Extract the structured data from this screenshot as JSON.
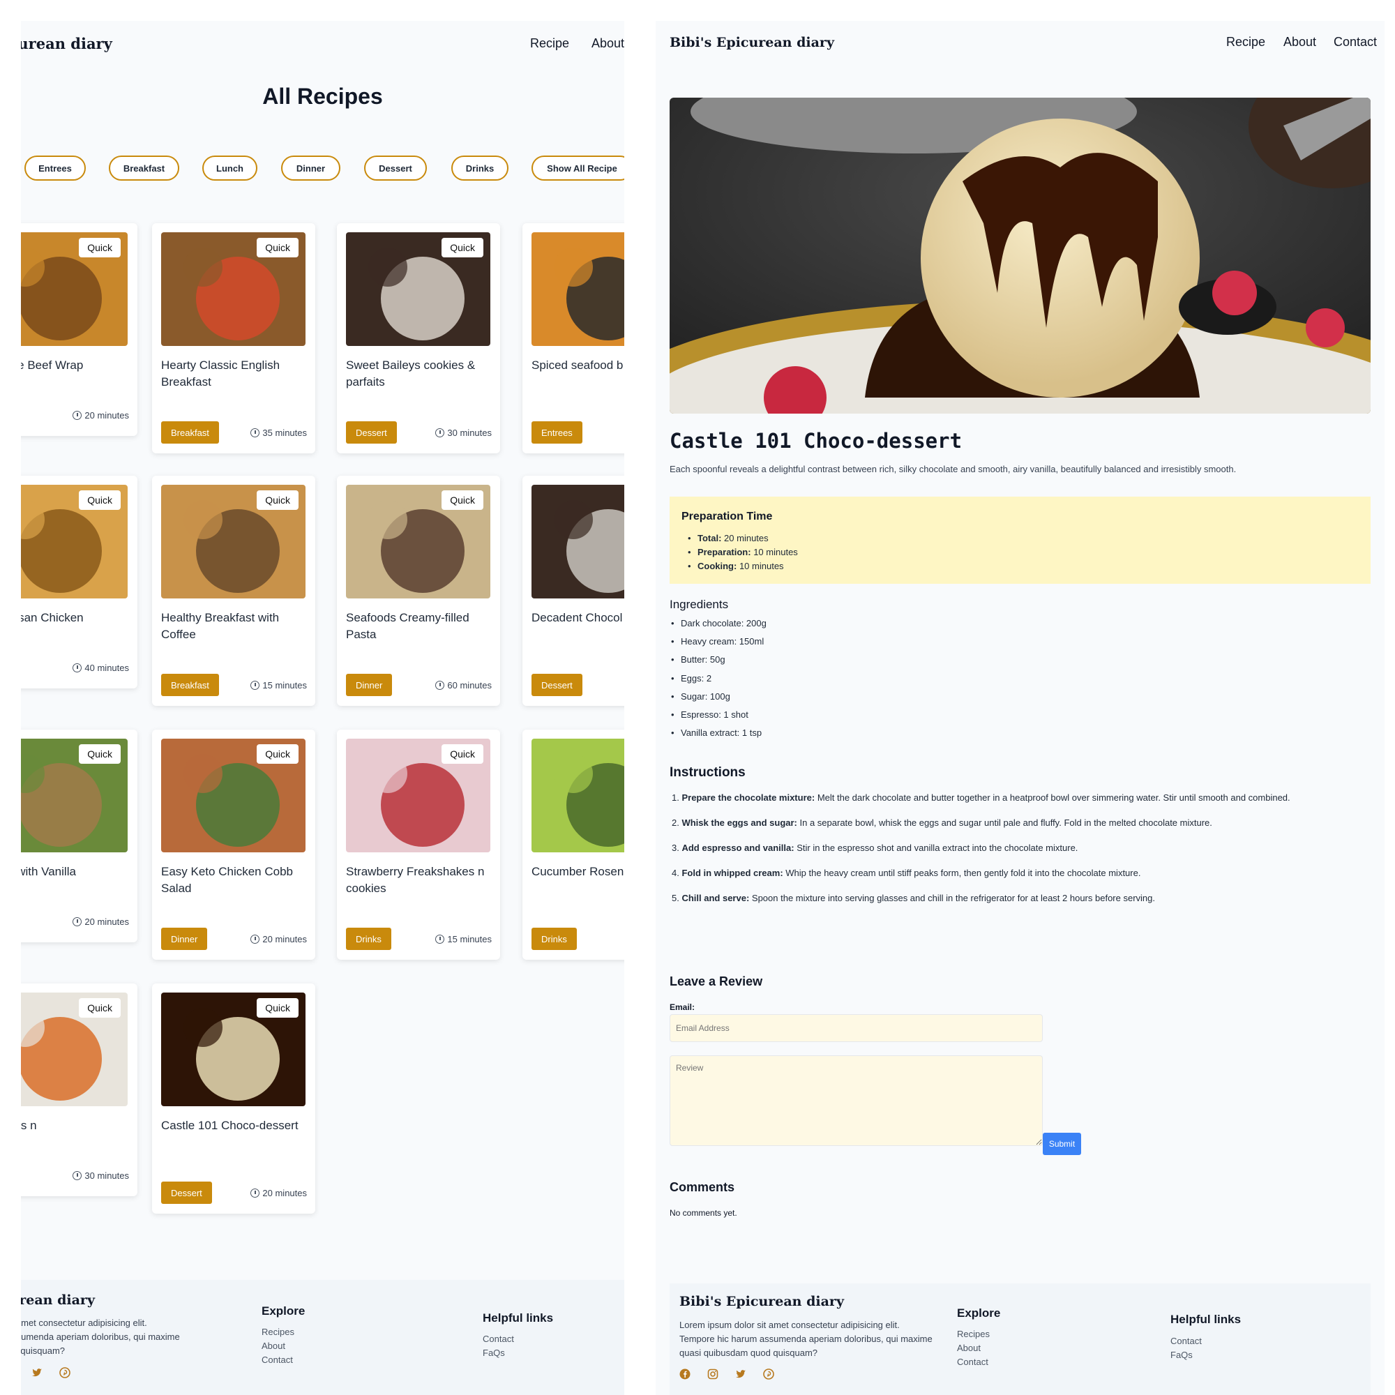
{
  "left": {
    "brand": "Bibi's Epicurean diary",
    "nav": [
      "Recipe",
      "About"
    ],
    "title": "All Recipes",
    "filters": [
      "Entrees",
      "Breakfast",
      "Lunch",
      "Dinner",
      "Dessert",
      "Drinks",
      "Show All Recipe"
    ],
    "quick_label": "Quick",
    "cards": [
      {
        "title": "Cheese Beef Wrap",
        "category": "",
        "time": "20 minutes"
      },
      {
        "title": "Hearty Classic English Breakfast",
        "category": "Breakfast",
        "time": "35 minutes"
      },
      {
        "title": "Sweet Baileys cookies & parfaits",
        "category": "Dessert",
        "time": "30 minutes"
      },
      {
        "title": "Spiced seafood b sesame",
        "category": "Entrees",
        "time": ""
      },
      {
        "title": "Parmesan Chicken",
        "category": "",
        "time": "40 minutes"
      },
      {
        "title": "Healthy Breakfast with Coffee",
        "category": "Breakfast",
        "time": "15 minutes"
      },
      {
        "title": "Seafoods Creamy-filled Pasta",
        "category": "Dinner",
        "time": "60 minutes"
      },
      {
        "title": "Decadent Chocol Cake",
        "category": "Dessert",
        "time": ""
      },
      {
        "title": "Pasta with Vanilla",
        "category": "",
        "time": "20 minutes"
      },
      {
        "title": "Easy Keto Chicken Cobb Salad",
        "category": "Dinner",
        "time": "20 minutes"
      },
      {
        "title": "Strawberry Freakshakes n cookies",
        "category": "Drinks",
        "time": "15 minutes"
      },
      {
        "title": "Cucumber Rosen Tonic",
        "category": "Drinks",
        "time": ""
      },
      {
        "title": "Shrimps n",
        "category": "",
        "time": "30 minutes"
      },
      {
        "title": "Castle 101 Choco-dessert",
        "category": "Dessert",
        "time": "20 minutes"
      }
    ],
    "footer": {
      "brand": "Bibi's Epicurean diary",
      "text": [
        "Lorem ipsum dolor sit amet consectetur adipisicing elit.",
        "Tempore hic harum assumenda aperiam doloribus, qui maxime",
        "quasi quibusdam quod quisquam?"
      ],
      "explore_title": "Explore",
      "explore_links": [
        "Recipes",
        "About",
        "Contact"
      ],
      "helpful_title": "Helpful links",
      "helpful_links": [
        "Contact",
        "FaQs"
      ]
    }
  },
  "right": {
    "brand": "Bibi's Epicurean diary",
    "nav": [
      "Recipe",
      "About",
      "Contact"
    ],
    "recipe_title": "Castle 101 Choco-dessert",
    "description": "Each spoonful reveals a delightful contrast between rich, silky chocolate and smooth, airy vanilla, beautifully balanced and irresistibly smooth.",
    "prep_title": "Preparation Time",
    "prep": [
      {
        "label": "Total:",
        "value": "20 minutes"
      },
      {
        "label": "Preparation:",
        "value": "10 minutes"
      },
      {
        "label": "Cooking:",
        "value": "10 minutes"
      }
    ],
    "ingredients_title": "Ingredients",
    "ingredients": [
      "Dark chocolate: 200g",
      "Heavy cream: 150ml",
      "Butter: 50g",
      "Eggs: 2",
      "Sugar: 100g",
      "Espresso: 1 shot",
      "Vanilla extract: 1 tsp"
    ],
    "instructions_title": "Instructions",
    "instructions": [
      {
        "num": "1.",
        "label": "Prepare the chocolate mixture:",
        "text": "Melt the dark chocolate and butter together in a heatproof bowl over simmering water. Stir until smooth and combined."
      },
      {
        "num": "2.",
        "label": "Whisk the eggs and sugar:",
        "text": "In a separate bowl, whisk the eggs and sugar until pale and fluffy. Fold in the melted chocolate mixture."
      },
      {
        "num": "3.",
        "label": "Add espresso and vanilla:",
        "text": "Stir in the espresso shot and vanilla extract into the chocolate mixture."
      },
      {
        "num": "4.",
        "label": "Fold in whipped cream:",
        "text": "Whip the heavy cream until stiff peaks form, then gently fold it into the chocolate mixture."
      },
      {
        "num": "5.",
        "label": "Chill and serve:",
        "text": "Spoon the mixture into serving glasses and chill in the refrigerator for at least 2 hours before serving."
      }
    ],
    "review_title": "Leave a Review",
    "email_label": "Email:",
    "email_placeholder": "Email Address",
    "review_placeholder": "Review",
    "submit_label": "Submit",
    "comments_title": "Comments",
    "no_comments": "No comments yet.",
    "footer": {
      "brand": "Bibi's Epicurean diary",
      "text": [
        "Lorem ipsum dolor sit amet consectetur adipisicing elit.",
        "Tempore hic harum assumenda aperiam doloribus, qui maxime",
        "quasi quibusdam quod quisquam?"
      ],
      "explore_title": "Explore",
      "explore_links": [
        "Recipes",
        "About",
        "Contact"
      ],
      "helpful_title": "Helpful links",
      "helpful_links": [
        "Contact",
        "FaQs"
      ],
      "social_icons": [
        "facebook-icon",
        "instagram-icon",
        "twitter-icon",
        "pinterest-icon"
      ]
    }
  },
  "colors": {
    "accent": "#c98a0c",
    "prep_bg": "#fef6c4",
    "submit": "#3b82f6",
    "input_bg": "#fef9e4"
  }
}
